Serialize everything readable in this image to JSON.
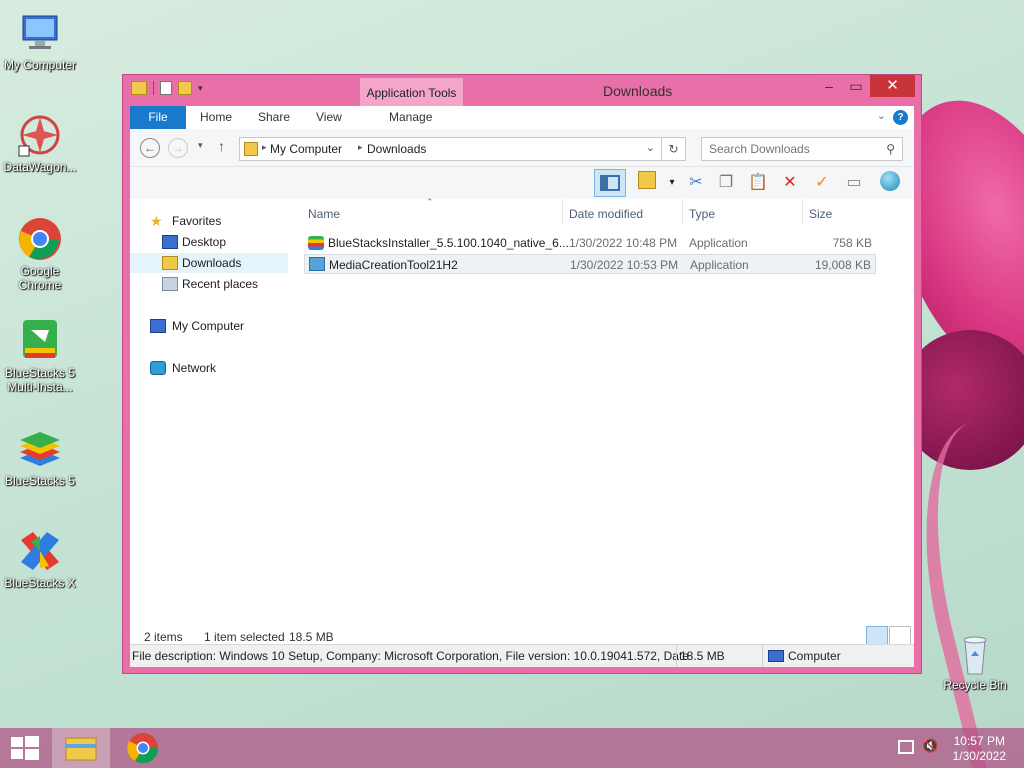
{
  "desktop": {
    "icons": [
      {
        "label": "My Computer"
      },
      {
        "label": "DataWagon..."
      },
      {
        "label": "Google Chrome"
      },
      {
        "label": "BlueStacks 5 Multi-Insta..."
      },
      {
        "label": "BlueStacks 5"
      },
      {
        "label": "BlueStacks X"
      },
      {
        "label": "Recycle Bin"
      }
    ]
  },
  "window": {
    "title": "Downloads",
    "context_tab": "Application Tools",
    "ribbon_tabs": [
      "File",
      "Home",
      "Share",
      "View",
      "Manage"
    ],
    "address": {
      "segments": [
        "My Computer",
        "Downloads"
      ]
    },
    "search_placeholder": "Search Downloads",
    "nav": {
      "favorites": "Favorites",
      "desktop": "Desktop",
      "downloads": "Downloads",
      "recent": "Recent places",
      "computer": "My Computer",
      "network": "Network"
    },
    "columns": [
      "Name",
      "Date modified",
      "Type",
      "Size"
    ],
    "files": [
      {
        "name": "BlueStacksInstaller_5.5.100.1040_native_6...",
        "date": "1/30/2022 10:48 PM",
        "type": "Application",
        "size": "758 KB"
      },
      {
        "name": "MediaCreationTool21H2",
        "date": "1/30/2022 10:53 PM",
        "type": "Application",
        "size": "19,008 KB"
      }
    ],
    "status": {
      "items": "2 items",
      "selected": "1 item selected",
      "selected_size": "18.5 MB",
      "description": "File description: Windows 10 Setup, Company: Microsoft Corporation, File version: 10.0.19041.572, Date",
      "desc_size": "18.5 MB",
      "location": "Computer"
    }
  },
  "taskbar": {
    "time": "10:57 PM",
    "date": "1/30/2022"
  }
}
